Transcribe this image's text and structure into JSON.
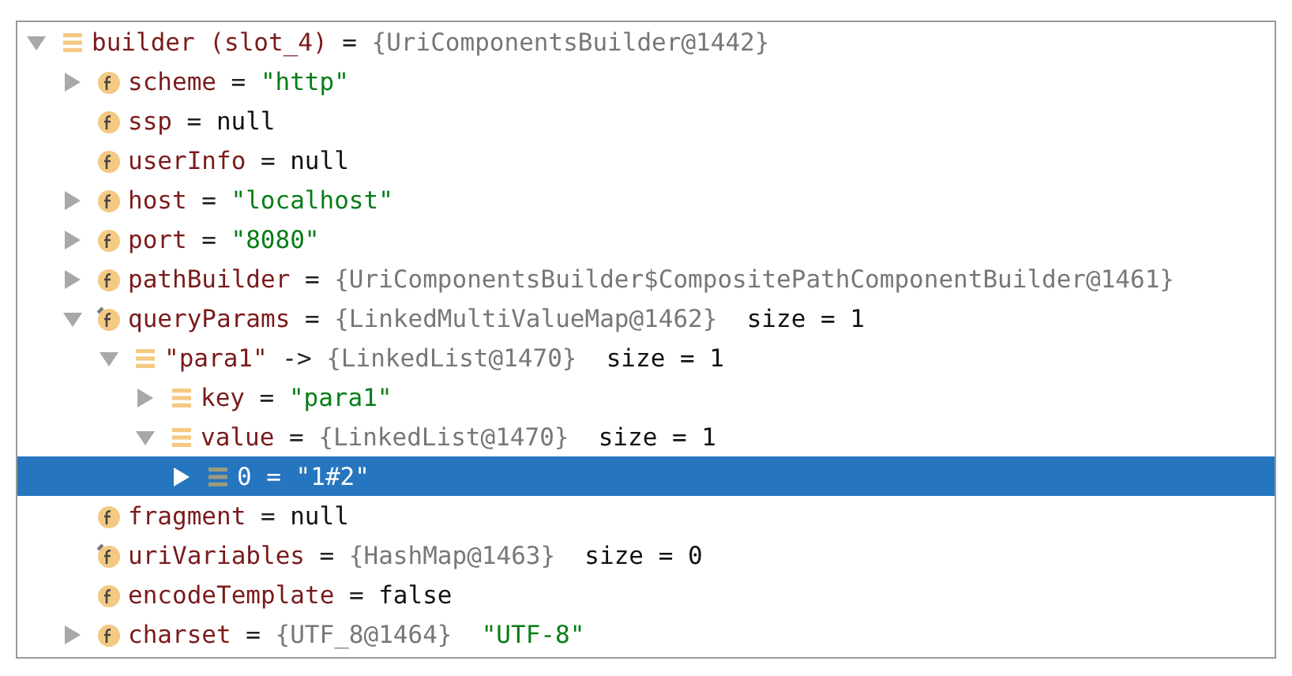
{
  "tree": [
    {
      "kind": "entry",
      "name": "builder (slot_4)",
      "op": "=",
      "value": [
        {
          "kind": "object",
          "text": "{UriComponentsBuilder@1442}"
        }
      ],
      "expanded": true,
      "selected": false,
      "children": [
        {
          "kind": "field",
          "name": "scheme",
          "op": "=",
          "value": [
            {
              "kind": "string",
              "text": "\"http\""
            }
          ],
          "expanded": false,
          "selected": false
        },
        {
          "kind": "field",
          "name": "ssp",
          "op": "=",
          "value": [
            {
              "kind": "literal",
              "text": "null"
            }
          ],
          "selected": false
        },
        {
          "kind": "field",
          "name": "userInfo",
          "op": "=",
          "value": [
            {
              "kind": "literal",
              "text": "null"
            }
          ],
          "selected": false
        },
        {
          "kind": "field",
          "name": "host",
          "op": "=",
          "value": [
            {
              "kind": "string",
              "text": "\"localhost\""
            }
          ],
          "expanded": false,
          "selected": false
        },
        {
          "kind": "field",
          "name": "port",
          "op": "=",
          "value": [
            {
              "kind": "string",
              "text": "\"8080\""
            }
          ],
          "expanded": false,
          "selected": false
        },
        {
          "kind": "field",
          "name": "pathBuilder",
          "op": "=",
          "value": [
            {
              "kind": "object",
              "text": "{UriComponentsBuilder$CompositePathComponentBuilder@1461}"
            }
          ],
          "expanded": false,
          "selected": false
        },
        {
          "kind": "field-final",
          "name": "queryParams",
          "op": "=",
          "value": [
            {
              "kind": "object",
              "text": "{LinkedMultiValueMap@1462}"
            },
            {
              "kind": "literal",
              "text": "size = 1"
            }
          ],
          "expanded": true,
          "selected": false,
          "children": [
            {
              "kind": "entry",
              "name": "\"para1\"",
              "op": "->",
              "value": [
                {
                  "kind": "object",
                  "text": "{LinkedList@1470}"
                },
                {
                  "kind": "literal",
                  "text": "size = 1"
                }
              ],
              "expanded": true,
              "selected": false,
              "children": [
                {
                  "kind": "entry",
                  "name": "key",
                  "op": "=",
                  "value": [
                    {
                      "kind": "string",
                      "text": "\"para1\""
                    }
                  ],
                  "expanded": false,
                  "selected": false
                },
                {
                  "kind": "entry",
                  "name": "value",
                  "op": "=",
                  "value": [
                    {
                      "kind": "object",
                      "text": "{LinkedList@1470}"
                    },
                    {
                      "kind": "literal",
                      "text": "size = 1"
                    }
                  ],
                  "expanded": true,
                  "selected": false,
                  "children": [
                    {
                      "kind": "entry",
                      "name": "0",
                      "op": "=",
                      "value": [
                        {
                          "kind": "string",
                          "text": "\"1#2\""
                        }
                      ],
                      "expanded": false,
                      "selected": true
                    }
                  ]
                }
              ]
            }
          ]
        },
        {
          "kind": "field",
          "name": "fragment",
          "op": "=",
          "value": [
            {
              "kind": "literal",
              "text": "null"
            }
          ],
          "selected": false
        },
        {
          "kind": "field-final",
          "name": "uriVariables",
          "op": "=",
          "value": [
            {
              "kind": "object",
              "text": "{HashMap@1463}"
            },
            {
              "kind": "literal",
              "text": "size = 0"
            }
          ],
          "selected": false
        },
        {
          "kind": "field",
          "name": "encodeTemplate",
          "op": "=",
          "value": [
            {
              "kind": "literal",
              "text": "false"
            }
          ],
          "selected": false
        },
        {
          "kind": "field",
          "name": "charset",
          "op": "=",
          "value": [
            {
              "kind": "object",
              "text": "{UTF_8@1464}"
            },
            {
              "kind": "string",
              "text": "\"UTF-8\""
            }
          ],
          "expanded": false,
          "selected": false
        }
      ]
    }
  ]
}
